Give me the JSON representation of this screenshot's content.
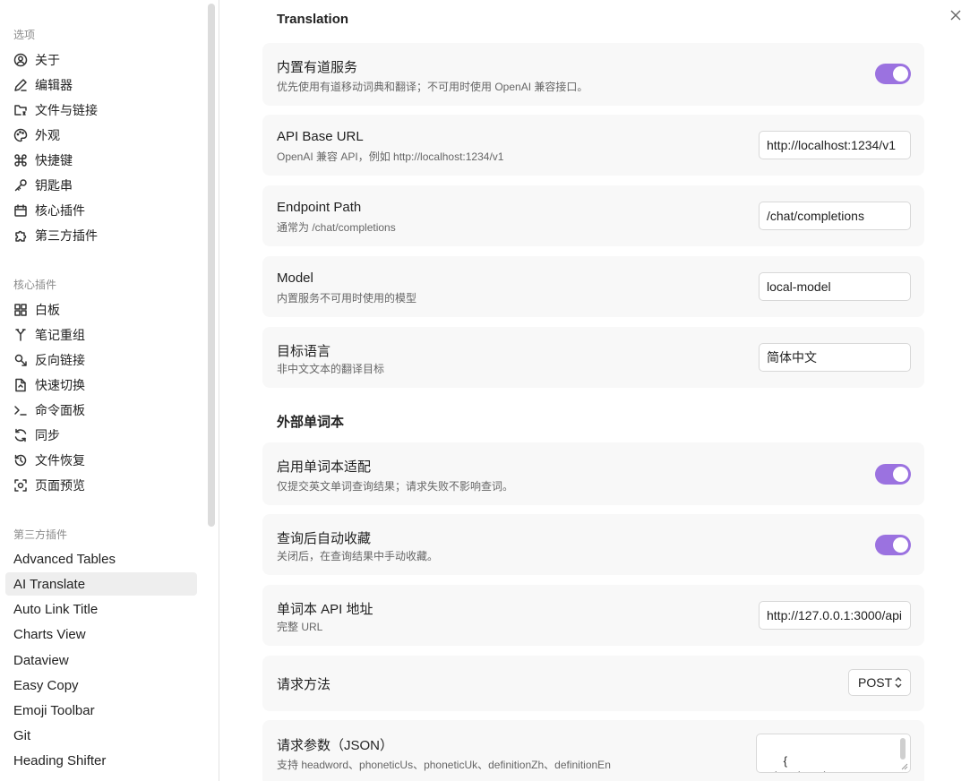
{
  "sidebar": {
    "section_options": "选项",
    "options": [
      {
        "label": "关于",
        "icon": "user-circle-icon"
      },
      {
        "label": "编辑器",
        "icon": "pen-icon"
      },
      {
        "label": "文件与链接",
        "icon": "folder-link-icon"
      },
      {
        "label": "外观",
        "icon": "palette-icon"
      },
      {
        "label": "快捷键",
        "icon": "command-icon"
      },
      {
        "label": "钥匙串",
        "icon": "key-icon"
      },
      {
        "label": "核心插件",
        "icon": "calendar-plugin-icon"
      },
      {
        "label": "第三方插件",
        "icon": "puzzle-icon"
      }
    ],
    "section_core": "核心插件",
    "core": [
      {
        "label": "白板",
        "icon": "canvas-grid-icon"
      },
      {
        "label": "笔记重组",
        "icon": "merge-icon"
      },
      {
        "label": "反向链接",
        "icon": "backlink-icon"
      },
      {
        "label": "快速切换",
        "icon": "file-switch-icon"
      },
      {
        "label": "命令面板",
        "icon": "terminal-icon"
      },
      {
        "label": "同步",
        "icon": "sync-icon"
      },
      {
        "label": "文件恢复",
        "icon": "history-icon"
      },
      {
        "label": "页面预览",
        "icon": "preview-icon"
      }
    ],
    "section_third": "第三方插件",
    "third": [
      {
        "label": "Advanced Tables",
        "active": false
      },
      {
        "label": "AI Translate",
        "active": true
      },
      {
        "label": "Auto Link Title",
        "active": false
      },
      {
        "label": "Charts View",
        "active": false
      },
      {
        "label": "Dataview",
        "active": false
      },
      {
        "label": "Easy Copy",
        "active": false
      },
      {
        "label": "Emoji Toolbar",
        "active": false
      },
      {
        "label": "Git",
        "active": false
      },
      {
        "label": "Heading Shifter",
        "active": false
      }
    ]
  },
  "main": {
    "heading_translation": "Translation",
    "builtin": {
      "name": "内置有道服务",
      "desc": "优先使用有道移动词典和翻译；不可用时使用 OpenAI 兼容接口。",
      "enabled": true
    },
    "api_base": {
      "name": "API Base URL",
      "desc": "OpenAI 兼容 API，例如 http://localhost:1234/v1",
      "value": "http://localhost:1234/v1"
    },
    "endpoint": {
      "name": "Endpoint Path",
      "desc": "通常为 /chat/completions",
      "value": "/chat/completions"
    },
    "model": {
      "name": "Model",
      "desc": "内置服务不可用时使用的模型",
      "value": "local-model"
    },
    "target_lang": {
      "name": "目标语言",
      "desc": "非中文文本的翻译目标",
      "value": "简体中文"
    },
    "heading_wordbook": "外部单词本",
    "enable_wordbook": {
      "name": "启用单词本适配",
      "desc": "仅提交英文单词查询结果；请求失败不影响查词。",
      "enabled": true
    },
    "auto_collect": {
      "name": "查询后自动收藏",
      "desc": "关闭后，在查询结果中手动收藏。",
      "enabled": true
    },
    "wordbook_api": {
      "name": "单词本 API 地址",
      "desc": "完整 URL",
      "value": "http://127.0.0.1:3000/api"
    },
    "method": {
      "name": "请求方法",
      "value": "POST"
    },
    "params": {
      "name": "请求参数（JSON）",
      "desc": "支持 headword、phoneticUs、phoneticUk、definitionZh、definitionEn",
      "value": "{\n  \"headword\": \"\n  \"\"    \"\""
    }
  },
  "colors": {
    "accent": "#9b72e0"
  }
}
